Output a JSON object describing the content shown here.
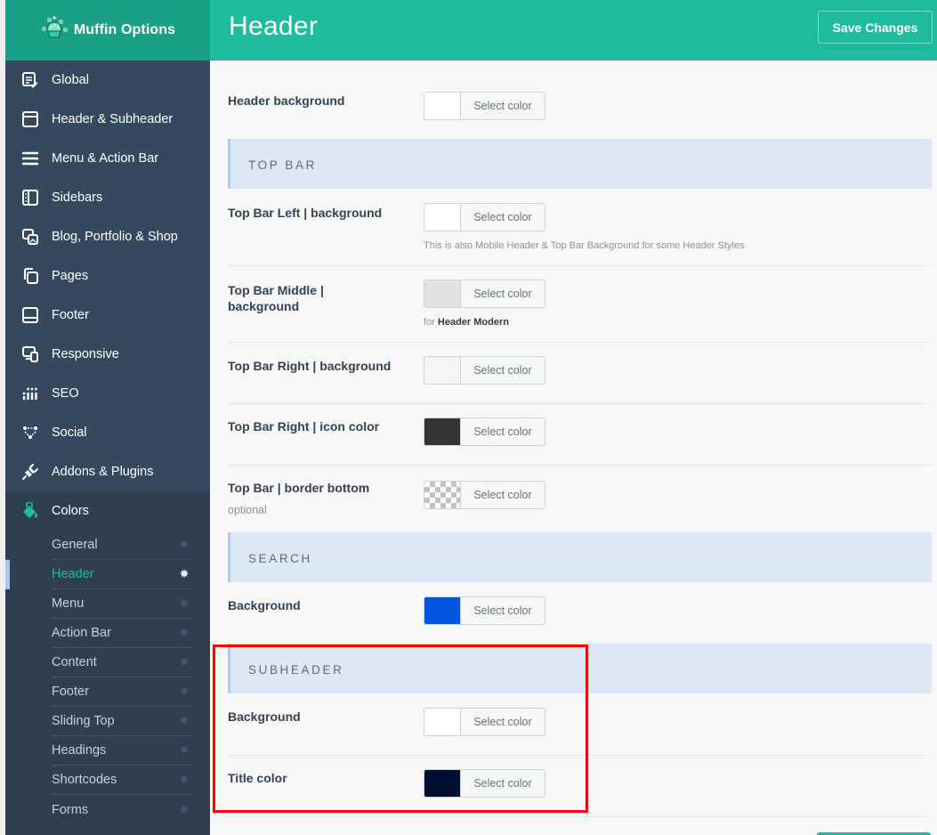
{
  "brand": {
    "name": "Muffin Options",
    "icon": "muffin-icon"
  },
  "header": {
    "title": "Header",
    "save_label": "Save Changes"
  },
  "sidebar": {
    "items": [
      {
        "label": "Global",
        "icon": "global-edit-icon"
      },
      {
        "label": "Header & Subheader",
        "icon": "header-window-icon"
      },
      {
        "label": "Menu & Action Bar",
        "icon": "menu-bars-icon"
      },
      {
        "label": "Sidebars",
        "icon": "sidebar-layout-icon"
      },
      {
        "label": "Blog, Portfolio & Shop",
        "icon": "blog-media-icon"
      },
      {
        "label": "Pages",
        "icon": "pages-copy-icon"
      },
      {
        "label": "Footer",
        "icon": "footer-layout-icon"
      },
      {
        "label": "Responsive",
        "icon": "responsive-devices-icon"
      },
      {
        "label": "SEO",
        "icon": "seo-bars-icon"
      },
      {
        "label": "Social",
        "icon": "social-network-icon"
      },
      {
        "label": "Addons & Plugins",
        "icon": "plug-icon"
      },
      {
        "label": "Colors",
        "icon": "paint-bucket-icon",
        "active": true
      }
    ],
    "colors_submenu": [
      {
        "label": "General"
      },
      {
        "label": "Header",
        "current": true
      },
      {
        "label": "Menu"
      },
      {
        "label": "Action Bar"
      },
      {
        "label": "Content"
      },
      {
        "label": "Footer"
      },
      {
        "label": "Sliding Top"
      },
      {
        "label": "Headings"
      },
      {
        "label": "Shortcodes"
      },
      {
        "label": "Forms"
      }
    ]
  },
  "picker_label": "Select color",
  "fields": {
    "header_background": {
      "label": "Header background",
      "color": "#ffffff"
    },
    "top_bar_section": "TOP BAR",
    "top_bar_left": {
      "label": "Top Bar Left | background",
      "color": "#ffffff",
      "hint": "This is also Mobile Header & Top Bar Background for some Header Styles"
    },
    "top_bar_middle": {
      "label": "Top Bar Middle | background",
      "color": "#e2e2e2",
      "hint_prefix": "for",
      "hint_bold": "Header Modern"
    },
    "top_bar_right_bg": {
      "label": "Top Bar Right | background",
      "color": "#f4f4f4"
    },
    "top_bar_right_icon": {
      "label": "Top Bar Right | icon color",
      "color": "#333333"
    },
    "top_bar_border": {
      "label": "Top Bar | border bottom",
      "sublabel": "optional",
      "color": "transparent"
    },
    "search_section": "SEARCH",
    "search_background": {
      "label": "Background",
      "color": "#0056e0"
    },
    "subheader_section": "SUBHEADER",
    "subheader_background": {
      "label": "Background",
      "color": "#ffffff"
    },
    "subheader_title": {
      "label": "Title color",
      "color": "#001034"
    }
  },
  "colors": {
    "brand": "#19a085",
    "topbar": "#1dbc9c",
    "sidebar": "#34495e",
    "active_text": "#1fbc9c",
    "highlight": "#ff0000"
  }
}
